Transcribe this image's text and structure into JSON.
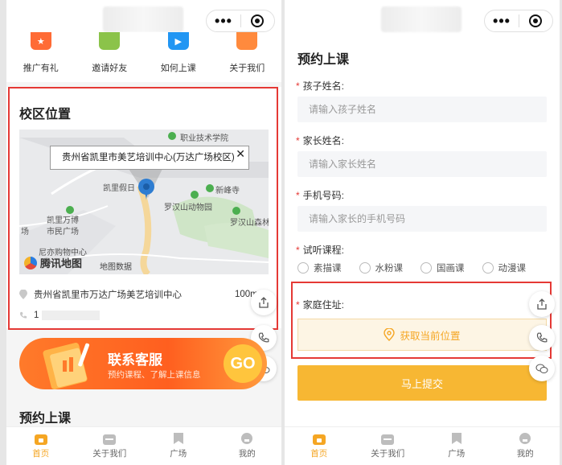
{
  "left": {
    "quick_nav": [
      {
        "label": "推广有礼",
        "icon": "star-icon",
        "color": "#ff6b35"
      },
      {
        "label": "邀请好友",
        "icon": "invite-icon",
        "color": "#8bc34a"
      },
      {
        "label": "如何上课",
        "icon": "play-icon",
        "color": "#2196f3"
      },
      {
        "label": "关于我们",
        "icon": "document-icon",
        "color": "#ff8a3d"
      }
    ],
    "campus": {
      "title": "校区位置",
      "map_bubble": "贵州省凯里市美艺培训中心(万达广场校区)",
      "map_labels": [
        "职业技术学院",
        "凯里假日",
        "新峰寺",
        "罗汉山动物园",
        "罗汉山森林",
        "凯里万博",
        "市民广场",
        "场",
        "尼亦购物中心"
      ],
      "map_brand": "腾讯地图",
      "map_data_label": "地图数据",
      "address": "贵州省凯里市万达广场美艺培训中心",
      "distance": "100m",
      "phone_prefix": "1"
    },
    "banner": {
      "title": "联系客服",
      "subtitle": "预约课程、了解上课信息",
      "go": "GO"
    },
    "booking_title": "预约上课"
  },
  "right": {
    "title": "预约上课",
    "fields": [
      {
        "label": "孩子姓名:",
        "placeholder": "请输入孩子姓名"
      },
      {
        "label": "家长姓名:",
        "placeholder": "请输入家长姓名"
      },
      {
        "label": "手机号码:",
        "placeholder": "请输入家长的手机号码"
      }
    ],
    "course_label": "试听课程:",
    "courses": [
      "素描课",
      "水粉课",
      "国画课",
      "动漫课"
    ],
    "address_label": "家庭住址:",
    "locate_button": "获取当前位置",
    "submit": "马上提交"
  },
  "tabbar": [
    {
      "label": "首页",
      "icon": "home-icon",
      "active": true
    },
    {
      "label": "关于我们",
      "icon": "calendar-icon",
      "active": false
    },
    {
      "label": "广场",
      "icon": "bookmark-icon",
      "active": false
    },
    {
      "label": "我的",
      "icon": "user-icon",
      "active": false
    }
  ],
  "colors": {
    "accent": "#f5a623",
    "highlight": "#e53935",
    "banner": "#ff6b2c"
  }
}
